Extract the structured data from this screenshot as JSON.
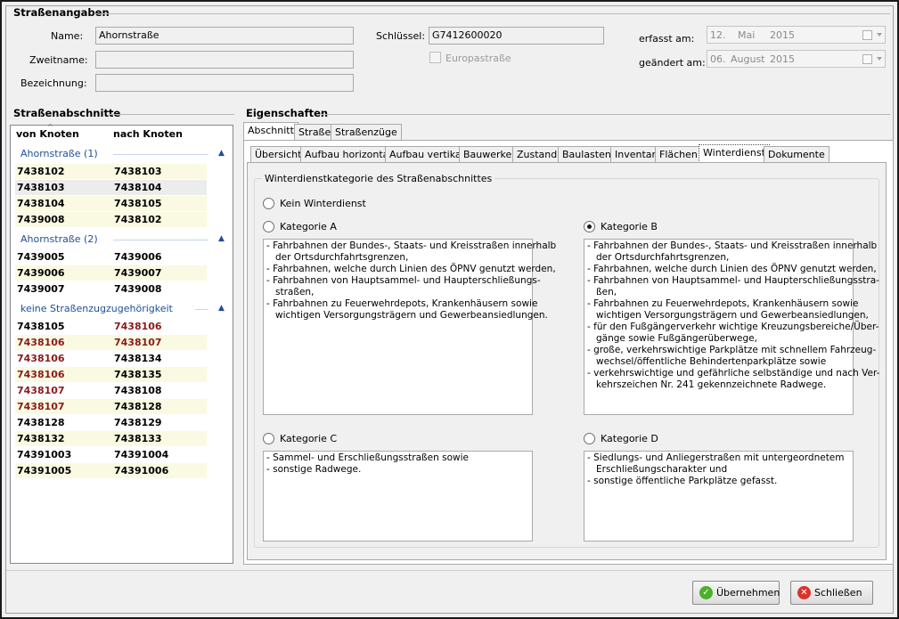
{
  "street": {
    "group_title": "Straßenangaben",
    "name_label": "Name:",
    "name_value": "Ahornstraße",
    "second_name_label": "Zweitname:",
    "second_name_value": "",
    "description_label": "Bezeichnung:",
    "description_value": "",
    "key_label": "Schlüssel:",
    "key_value": "G7412600020",
    "europe_label": "Europastraße",
    "europe_checked": false,
    "created_label": "erfasst am:",
    "created_day": "12.",
    "created_month": "Mai",
    "created_year": "2015",
    "changed_label": "geändert am:",
    "changed_day": "06.",
    "changed_month": "August",
    "changed_year": "2015"
  },
  "segments": {
    "title": "Straßenabschnitte",
    "col_from": "von Knoten",
    "col_to": "nach Knoten",
    "groups": [
      {
        "header": "Ahornstraße (1)",
        "rows": [
          {
            "from": "7438102",
            "to": "7438103"
          },
          {
            "from": "7438103",
            "to": "7438104"
          },
          {
            "from": "7438104",
            "to": "7438105"
          },
          {
            "from": "7439008",
            "to": "7438102"
          }
        ]
      },
      {
        "header": "Ahornstraße (2)",
        "rows": [
          {
            "from": "7439005",
            "to": "7439006"
          },
          {
            "from": "7439006",
            "to": "7439007"
          },
          {
            "from": "7439007",
            "to": "7439008"
          }
        ]
      },
      {
        "header": "keine Straßenzugzugehörigkeit",
        "rows": [
          {
            "from": "7438105",
            "to": "7438106"
          },
          {
            "from": "7438106",
            "to": "7438107"
          },
          {
            "from": "7438106",
            "to": "7438134"
          },
          {
            "from": "7438106",
            "to": "7438135"
          },
          {
            "from": "7438107",
            "to": "7438108"
          },
          {
            "from": "7438107",
            "to": "7438128"
          },
          {
            "from": "7438128",
            "to": "7438129"
          },
          {
            "from": "7438132",
            "to": "7438133"
          },
          {
            "from": "74391003",
            "to": "74391004"
          },
          {
            "from": "74391005",
            "to": "74391006"
          }
        ]
      }
    ]
  },
  "properties": {
    "title": "Eigenschaften",
    "main_tabs": [
      "Abschnitt",
      "Straße",
      "Straßenzüge"
    ],
    "sub_tabs": [
      "Übersicht",
      "Aufbau horizontal",
      "Aufbau vertikal",
      "Bauwerke",
      "Zustand",
      "Baulasten",
      "Inventar",
      "Flächen",
      "Winterdienst",
      "Dokumente"
    ],
    "active_sub_tab": "Winterdienst",
    "winter": {
      "group_title": "Winterdienstkategorie des Straßenabschnittes",
      "none_label": "Kein Winterdienst",
      "selected": "Kategorie B",
      "cat_a": {
        "label": "Kategorie A",
        "lines": [
          "- Fahrbahnen der Bundes-, Staats- und Kreisstraßen innerhalb",
          "   der Ortsdurchfahrtsgrenzen,",
          "- Fahrbahnen, welche durch Linien des ÖPNV genutzt werden,",
          "- Fahrbahnen von Hauptsammel- und Haupterschließungs-",
          "   straßen,",
          "- Fahrbahnen zu Feuerwehrdepots, Krankenhäusern sowie",
          "   wichtigen Versorgungsträgern und Gewerbeansiedlungen."
        ]
      },
      "cat_b": {
        "label": "Kategorie B",
        "lines": [
          "- Fahrbahnen der Bundes-, Staats- und Kreisstraßen innerhalb",
          "   der Ortsdurchfahrtsgrenzen,",
          "- Fahrbahnen, welche durch Linien des ÖPNV genutzt werden,",
          "- Fahrbahnen von Hauptsammel- und Haupterschließungsstra-",
          "   ßen,",
          "- Fahrbahnen zu Feuerwehrdepots, Krankenhäusern sowie",
          "   wichtigen Versorgungsträgern und Gewerbeansiedlungen,",
          "- für den Fußgängerverkehr wichtige Kreuzungsbereiche/Über-",
          "   gänge sowie Fußgängerüberwege,",
          "- große, verkehrswichtige Parkplätze mit schnellem Fahrzeug-",
          "   wechsel/öffentliche Behindertenparkplätze sowie",
          "- verkehrswichtige und gefährliche selbständige und nach Ver-",
          "   kehrszeichen Nr. 241 gekennzeichnete Radwege."
        ]
      },
      "cat_c": {
        "label": "Kategorie C",
        "lines": [
          "- Sammel- und Erschließungsstraßen sowie",
          "- sonstige Radwege."
        ]
      },
      "cat_d": {
        "label": "Kategorie D",
        "lines": [
          "- Siedlungs- und Anliegerstraßen mit untergeordnetem",
          "   Erschließungscharakter und",
          "- sonstige öffentliche Parkplätze gefasst."
        ]
      }
    }
  },
  "footer": {
    "accept_label": "Übernehmen",
    "close_label": "Schließen"
  },
  "colors": {
    "group_header": "#1f4e9a",
    "red_text": "#8b1a1a",
    "row_highlight": "#fafae3",
    "accept_icon": "#4caf2a",
    "close_icon": "#d9342b"
  }
}
